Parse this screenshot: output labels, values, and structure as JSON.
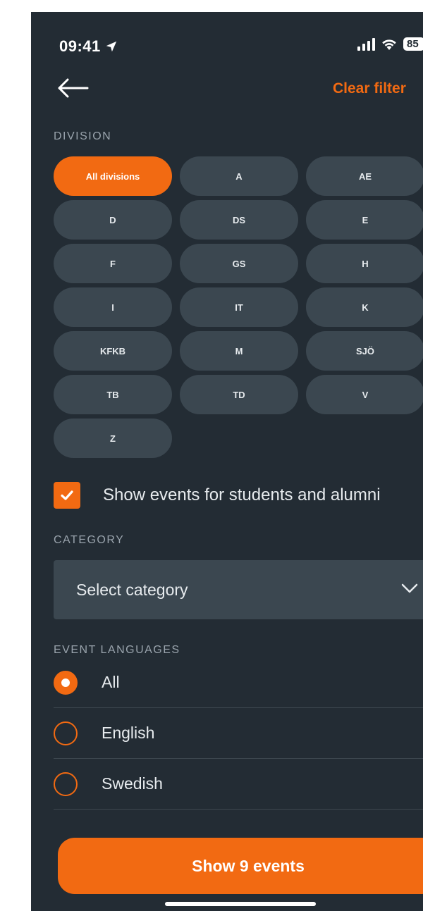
{
  "status_bar": {
    "time": "09:41",
    "battery": "85"
  },
  "header": {
    "clear_filter": "Clear filter"
  },
  "division": {
    "label": "DIVISION",
    "items": [
      "All divisions",
      "A",
      "AE",
      "D",
      "DS",
      "E",
      "F",
      "GS",
      "H",
      "I",
      "IT",
      "K",
      "KFKB",
      "M",
      "SJÖ",
      "TB",
      "TD",
      "V",
      "Z"
    ],
    "selected": "All divisions"
  },
  "students_alumni": {
    "label": "Show events for students and alumni",
    "checked": true
  },
  "category": {
    "label": "CATEGORY",
    "placeholder": "Select category"
  },
  "languages": {
    "label": "EVENT LANGUAGES",
    "options": [
      {
        "label": "All",
        "selected": true
      },
      {
        "label": "English",
        "selected": false
      },
      {
        "label": "Swedish",
        "selected": false
      }
    ]
  },
  "show_button": {
    "label": "Show 9 events"
  },
  "colors": {
    "accent": "#f26a12",
    "background": "#232c34",
    "chip": "#3b4750"
  }
}
